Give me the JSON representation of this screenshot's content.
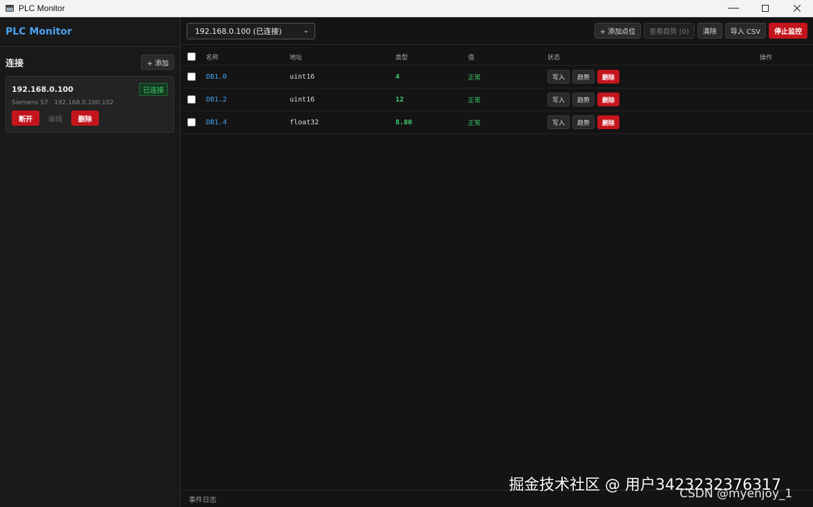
{
  "window": {
    "title": "PLC Monitor",
    "minimize": "—"
  },
  "sidebar": {
    "brand": "PLC Monitor",
    "section_title": "连接",
    "add_label": "+ 添加",
    "connection": {
      "host": "192.168.0.100",
      "status": "已连接",
      "model": "Siemens S7",
      "endpoint": "192.168.0.100:102",
      "disconnect_label": "断开",
      "edit_label": "编辑",
      "delete_label": "删除"
    }
  },
  "toolbar": {
    "connection_select": "192.168.0.100 (已连接)",
    "add_point_label": "+ 添加点位",
    "view_trend_label": "查看趋势 (0)",
    "clear_label": "清除",
    "import_label": "导入 CSV",
    "stop_label": "停止监控"
  },
  "table": {
    "headers": [
      "名称",
      "地址",
      "类型",
      "值",
      "状态",
      "操作"
    ],
    "rows": [
      {
        "name": "DB1.0",
        "type": "uint16",
        "value": "4",
        "status": "正常"
      },
      {
        "name": "DB1.2",
        "type": "uint16",
        "value": "12",
        "status": "正常"
      },
      {
        "name": "DB1.4",
        "type": "float32",
        "value": "8.80",
        "status": "正常"
      }
    ],
    "write_label": "写入",
    "trend_label": "趋势",
    "delete_label": "删除"
  },
  "log": {
    "label": "事件日志"
  },
  "watermark": {
    "line1": "掘金技术社区 @ 用户3423232376317",
    "line2": "CSDN @myenjoy_1"
  },
  "colors": {
    "accent": "#4aa3f0",
    "danger": "#c4151c",
    "ok": "#3ecf6a"
  }
}
